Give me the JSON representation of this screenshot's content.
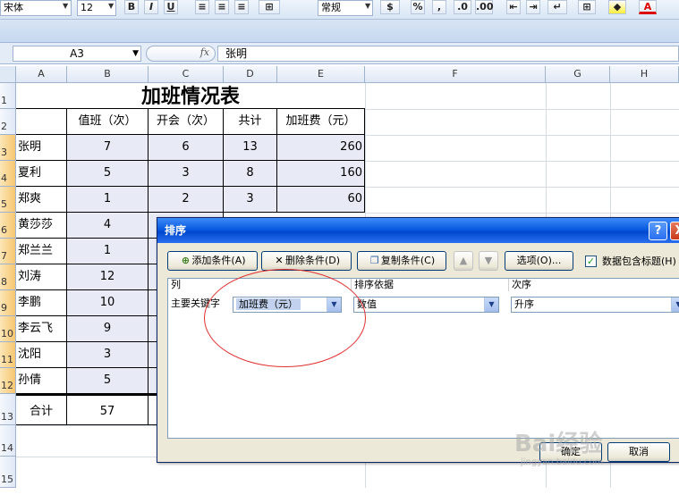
{
  "ribbon": {
    "font_name": "宋体",
    "font_size": "12",
    "bold": "B",
    "italic": "I",
    "underline": "U",
    "number_format": "常规",
    "percent": "%",
    "comma": ",",
    "font_color_letter": "A"
  },
  "formula_bar": {
    "name_box": "A3",
    "fx": "fx",
    "value": "张明"
  },
  "columns": [
    "A",
    "B",
    "C",
    "D",
    "E",
    "F",
    "G",
    "H"
  ],
  "rows": [
    "1",
    "2",
    "3",
    "4",
    "5",
    "6",
    "7",
    "8",
    "9",
    "10",
    "11",
    "12",
    "13",
    "14",
    "15"
  ],
  "sheet": {
    "title": "加班情况表",
    "headers": [
      "值班（次）",
      "开会（次）",
      "共计",
      "加班费（元）"
    ],
    "data": [
      {
        "name": "张明",
        "duty": "7",
        "meeting": "6",
        "total": "13",
        "fee": "260"
      },
      {
        "name": "夏利",
        "duty": "5",
        "meeting": "3",
        "total": "8",
        "fee": "160"
      },
      {
        "name": "郑爽",
        "duty": "1",
        "meeting": "2",
        "total": "3",
        "fee": "60"
      },
      {
        "name": "黄莎莎",
        "duty": "4"
      },
      {
        "name": "郑兰兰",
        "duty": "1"
      },
      {
        "name": "刘涛",
        "duty": "12"
      },
      {
        "name": "李鹏",
        "duty": "10"
      },
      {
        "name": "李云飞",
        "duty": "9"
      },
      {
        "name": "沈阳",
        "duty": "3"
      },
      {
        "name": "孙倩",
        "duty": "5"
      }
    ],
    "total_label": "合计",
    "total_duty": "57"
  },
  "dialog": {
    "title": "排序",
    "help": "?",
    "close": "X",
    "add_level": "添加条件(A)",
    "delete_level": "删除条件(D)",
    "copy_level": "复制条件(C)",
    "move_up": "▲",
    "move_down": "▼",
    "options": "选项(O)...",
    "has_headers": "数据包含标题(H)",
    "col_header": "列",
    "sort_on_header": "排序依据",
    "order_header": "次序",
    "row_label": "主要关键字",
    "column_value": "加班费（元）",
    "sort_on_value": "数值",
    "order_value": "升序",
    "ok": "确定",
    "cancel": "取消"
  },
  "watermark": {
    "brand": "Bai经验",
    "url": "jingyan.baidu.com"
  },
  "colors": {
    "title_bar": "#0a5ce0",
    "annotation_circle": "#e03030",
    "selected_header": "#f6c66f"
  }
}
